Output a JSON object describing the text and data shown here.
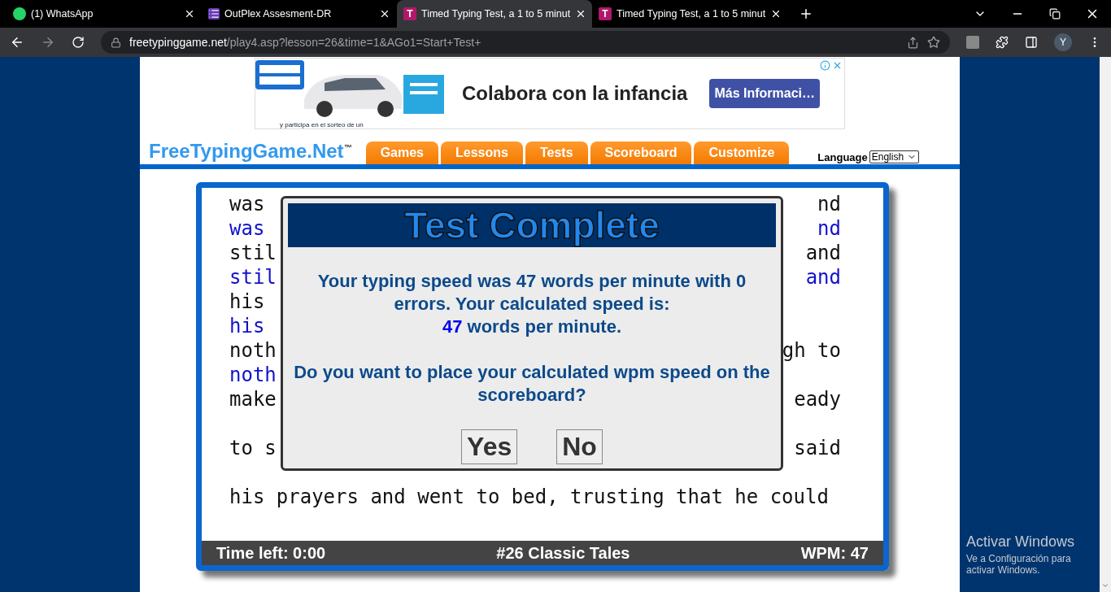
{
  "browser": {
    "tabs": [
      {
        "title": "(1) WhatsApp",
        "selected": false
      },
      {
        "title": "OutPlex Assesment-DR",
        "selected": false
      },
      {
        "title": "Timed Typing Test, a 1 to 5 minut",
        "favicon_text": "T",
        "selected": true
      },
      {
        "title": "Timed Typing Test, a 1 to 5 minut",
        "favicon_text": "T",
        "selected": false
      }
    ],
    "url_host": "freetypinggame.net",
    "url_path": "/play4.asp?lesson=26&time=1&AGo1=Start+Test+",
    "profile_initial": "Y"
  },
  "ad": {
    "headline": "Colabora con la infancia",
    "button": "Más Informaci…",
    "caption": "y participa en el sorteo de un"
  },
  "header": {
    "logo": "FreeTypingGame.Net$^{™}$",
    "nav": [
      "Games",
      "Lessons",
      "Tests",
      "Scoreboard",
      "Customize"
    ],
    "language_label": "Language",
    "language_value": "English"
  },
  "typing_area": {
    "lines": [
      {
        "kind": "text",
        "left": "was",
        "right": "nd",
        "typed": false
      },
      {
        "kind": "text",
        "left": "was",
        "right": "nd",
        "typed": true
      },
      {
        "kind": "text",
        "left": "stil",
        "right": "and",
        "typed": false
      },
      {
        "kind": "text",
        "left": "stil",
        "right": "and",
        "typed": true
      },
      {
        "kind": "text",
        "left": "his",
        "typed": false
      },
      {
        "kind": "text",
        "left": "his",
        "typed": true
      },
      {
        "kind": "text",
        "left": "noth",
        "right": "gh to",
        "typed": false
      },
      {
        "kind": "text",
        "left": "noth",
        "typed": true
      },
      {
        "kind": "text",
        "left": "make",
        "right": "eady",
        "typed": false
      },
      {
        "kind": "blank"
      },
      {
        "kind": "text",
        "left": "to s",
        "right": "said",
        "typed": false
      },
      {
        "kind": "blank"
      },
      {
        "kind": "text",
        "left": "his prayers and went to bed, trusting that he could",
        "typed": false
      }
    ]
  },
  "status_bar": {
    "time_left": "Time left: 0:00",
    "lesson": "#26 Classic Tales",
    "wpm": "WPM: 47"
  },
  "dialog": {
    "title": "Test Complete",
    "message": "Your typing speed was 47 words per minute with 0 errors. Your calculated speed is:",
    "calculated_value": "47",
    "calculated_unit": "words per minute.",
    "question": "Do you want to place your calculated wpm speed on the scoreboard?",
    "buttons": [
      "Yes",
      "No"
    ]
  },
  "os_notice": {
    "title": "Activar Windows",
    "text": "Ve a Configuración para activar Windows."
  }
}
